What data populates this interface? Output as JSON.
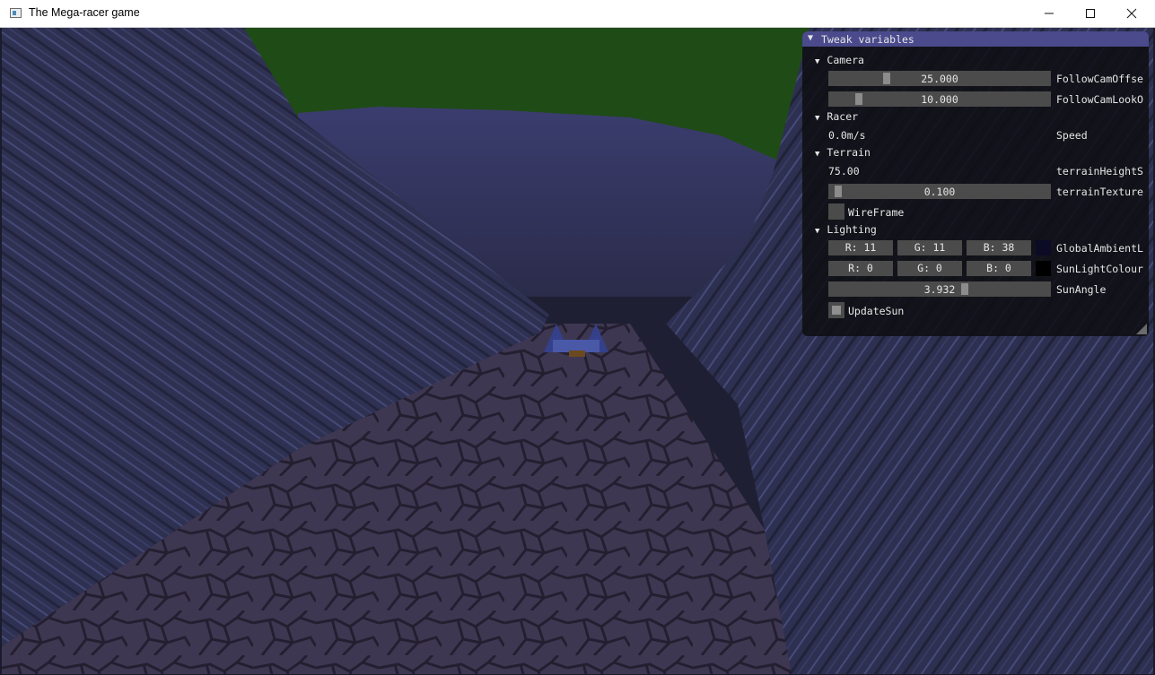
{
  "window": {
    "title": "The Mega-racer game"
  },
  "colors": {
    "sky": "#1f4b17",
    "panel_header": "#4a4a8c",
    "global_ambient_swatch": "#0b0b26",
    "sun_light_swatch": "#000000"
  },
  "panel": {
    "title": "Tweak variables",
    "sections": {
      "camera": {
        "title": "Camera",
        "follow_offset": {
          "value": "25.000",
          "label": "FollowCamOffse",
          "level": 0.25
        },
        "follow_lookat": {
          "value": "10.000",
          "label": "FollowCamLookO",
          "level": 0.12
        }
      },
      "racer": {
        "title": "Racer",
        "speed": {
          "value": "0.0m/s",
          "label": "Speed"
        }
      },
      "terrain": {
        "title": "Terrain",
        "height_scale": {
          "value": "75.00",
          "label": "terrainHeightS"
        },
        "texture": {
          "value": "0.100",
          "label": "terrainTexture",
          "level": 0.02
        },
        "wireframe": {
          "label": "WireFrame",
          "checked": false
        }
      },
      "lighting": {
        "title": "Lighting",
        "global_ambient": {
          "r": "R: 11",
          "g": "G: 11",
          "b": "B: 38",
          "label": "GlobalAmbientL"
        },
        "sun_light": {
          "r": "R:  0",
          "g": "G:  0",
          "b": "B:  0",
          "label": "SunLightColour"
        },
        "sun_angle": {
          "value": "3.932",
          "label": "SunAngle",
          "level": 0.62
        },
        "update_sun": {
          "label": "UpdateSun",
          "checked": true
        }
      }
    }
  }
}
